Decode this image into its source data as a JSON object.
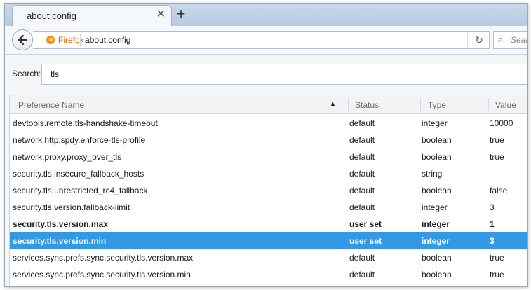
{
  "tab": {
    "title": "about:config",
    "close_label": "✕",
    "new_tab_label": "+"
  },
  "navbar": {
    "identity_label": "Firefox",
    "url": "about:config",
    "search_placeholder": "Sear"
  },
  "search": {
    "label": "Search:",
    "value": "tls"
  },
  "table": {
    "columns": [
      "Preference Name",
      "Status",
      "Type",
      "Value"
    ],
    "sort": {
      "column": "Preference Name",
      "direction": "descending"
    },
    "rows": [
      {
        "name": "devtools.remote.tls-handshake-timeout",
        "status": "default",
        "type": "integer",
        "value": "10000",
        "modified": false,
        "selected": false
      },
      {
        "name": "network.http.spdy.enforce-tls-profile",
        "status": "default",
        "type": "boolean",
        "value": "true",
        "modified": false,
        "selected": false
      },
      {
        "name": "network.proxy.proxy_over_tls",
        "status": "default",
        "type": "boolean",
        "value": "true",
        "modified": false,
        "selected": false
      },
      {
        "name": "security.tls.insecure_fallback_hosts",
        "status": "default",
        "type": "string",
        "value": "",
        "modified": false,
        "selected": false
      },
      {
        "name": "security.tls.unrestricted_rc4_fallback",
        "status": "default",
        "type": "boolean",
        "value": "false",
        "modified": false,
        "selected": false
      },
      {
        "name": "security.tls.version.fallback-limit",
        "status": "default",
        "type": "integer",
        "value": "3",
        "modified": false,
        "selected": false
      },
      {
        "name": "security.tls.version.max",
        "status": "user set",
        "type": "integer",
        "value": "1",
        "modified": true,
        "selected": false
      },
      {
        "name": "security.tls.version.min",
        "status": "user set",
        "type": "integer",
        "value": "3",
        "modified": true,
        "selected": true
      },
      {
        "name": "services.sync.prefs.sync.security.tls.version.max",
        "status": "default",
        "type": "boolean",
        "value": "true",
        "modified": false,
        "selected": false
      },
      {
        "name": "services.sync.prefs.sync.security.tls.version.min",
        "status": "default",
        "type": "boolean",
        "value": "true",
        "modified": false,
        "selected": false
      }
    ]
  },
  "colors": {
    "selection": "#3399e6",
    "firefox_accent": "#e66000"
  },
  "icons": [
    "back-arrow-icon",
    "firefox-logo-icon",
    "reload-icon",
    "search-icon",
    "sort-descending-icon",
    "close-icon",
    "plus-icon"
  ]
}
